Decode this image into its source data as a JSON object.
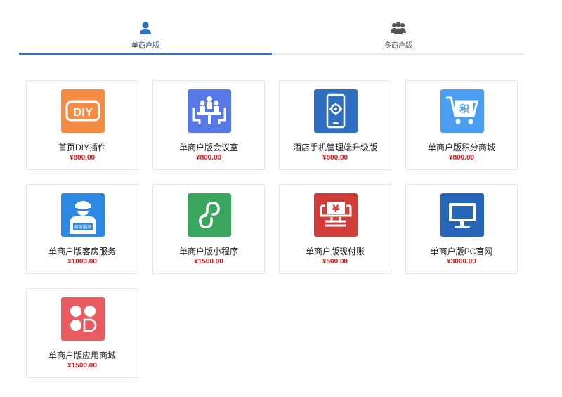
{
  "tabs": [
    {
      "label": "单商户版",
      "icon": "user-icon",
      "active": true
    },
    {
      "label": "多商户版",
      "icon": "users-group-icon",
      "active": false
    }
  ],
  "products": [
    {
      "name": "首页DIY插件",
      "price": "¥800.00",
      "icon": "diy-icon",
      "color": "#f58c45"
    },
    {
      "name": "单商户版会议室",
      "price": "¥800.00",
      "icon": "meeting-room-icon",
      "color": "#5878e8"
    },
    {
      "name": "酒店手机管理端升级版",
      "price": "¥800.00",
      "icon": "mobile-settings-icon",
      "color": "#2e6ec3"
    },
    {
      "name": "单商户版积分商城",
      "price": "¥800.00",
      "icon": "points-cart-icon",
      "color": "#4a9ef2"
    },
    {
      "name": "单商户版客房服务",
      "price": "¥1000.00",
      "icon": "room-service-icon",
      "color": "#2c88e0",
      "badge": "客房服务"
    },
    {
      "name": "单商户版小程序",
      "price": "¥1500.00",
      "icon": "mini-program-icon",
      "color": "#3aa55e"
    },
    {
      "name": "单商户版现付账",
      "price": "¥500.00",
      "icon": "cash-pay-icon",
      "color": "#d23d3a"
    },
    {
      "name": "单商户版PC官网",
      "price": "¥3000.00",
      "icon": "pc-monitor-icon",
      "color": "#2765b8"
    },
    {
      "name": "单商户版应用商城",
      "price": "¥1500.00",
      "icon": "app-store-icon",
      "color": "#e95c62"
    }
  ],
  "colors": {
    "tab_active_underline": "#2f74c6",
    "price": "#d0161b",
    "card_border": "#e2e5e9"
  }
}
